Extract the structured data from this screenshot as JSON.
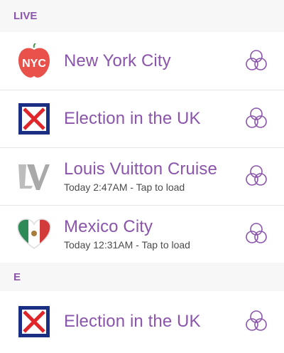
{
  "sections": [
    {
      "header": "LIVE",
      "items": [
        {
          "title": "New York City",
          "subtitle": "",
          "thumbnail": "nyc-apple-icon"
        },
        {
          "title": "Election in the UK",
          "subtitle": "",
          "thumbnail": "ballot-x-icon"
        },
        {
          "title": "Louis Vuitton Cruise",
          "subtitle": "Today 2:47AM - Tap to load",
          "thumbnail": "lv-monogram-icon"
        },
        {
          "title": "Mexico City",
          "subtitle": "Today 12:31AM - Tap to load",
          "thumbnail": "mexico-heart-icon"
        }
      ]
    },
    {
      "header": "E",
      "items": [
        {
          "title": "Election in the UK",
          "subtitle": "",
          "thumbnail": "ballot-x-icon"
        }
      ]
    }
  ],
  "thumbnail_text": {
    "nyc": "NYC"
  },
  "colors": {
    "accent": "#8a55ab",
    "header_bg": "#f7f7f8",
    "divider": "#e6e6ea",
    "apple_red": "#e8524a",
    "ballot_blue": "#1a2f84"
  },
  "action_icon": "story-ring-icon"
}
